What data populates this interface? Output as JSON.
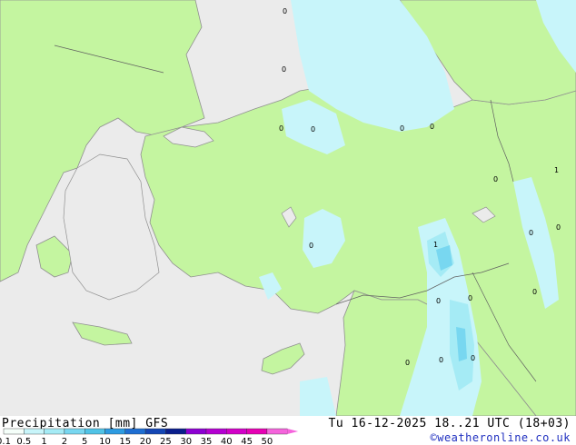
{
  "legend": {
    "title": "Precipitation [mm]  GFS",
    "ticks": [
      "0.1",
      "0.5",
      "1",
      "2",
      "5",
      "10",
      "15",
      "20",
      "25",
      "30",
      "35",
      "40",
      "45",
      "50"
    ],
    "swatch_colors": [
      "#f5fffa",
      "#c8f5fa",
      "#a5ebf5",
      "#78d7f0",
      "#50c3e6",
      "#2d9be1",
      "#1e6ed2",
      "#1446b4",
      "#0a1e8c",
      "#8c00d2",
      "#b400d2",
      "#d200c8",
      "#e600b4",
      "#f564dc"
    ]
  },
  "valid_time": "Tu 16-12-2025 18..21 UTC (18+03)",
  "credit": "©weatheronline.co.uk",
  "map": {
    "colors": {
      "sea": "#ebebeb",
      "land_outside": "#ebebeb",
      "land_forecast": "#c4f5a0",
      "precip_light": "#c8f5fa",
      "precip_medium": "#a5ebf5",
      "precip_heavy": "#78d7f0",
      "coast": "#909090",
      "border": "#606060"
    },
    "value_labels": [
      "0",
      "0",
      "0",
      "0",
      "0",
      "0",
      "0",
      "1",
      "0",
      "0",
      "0",
      "0",
      "1",
      "0",
      "0",
      "0",
      "0",
      "0"
    ]
  }
}
